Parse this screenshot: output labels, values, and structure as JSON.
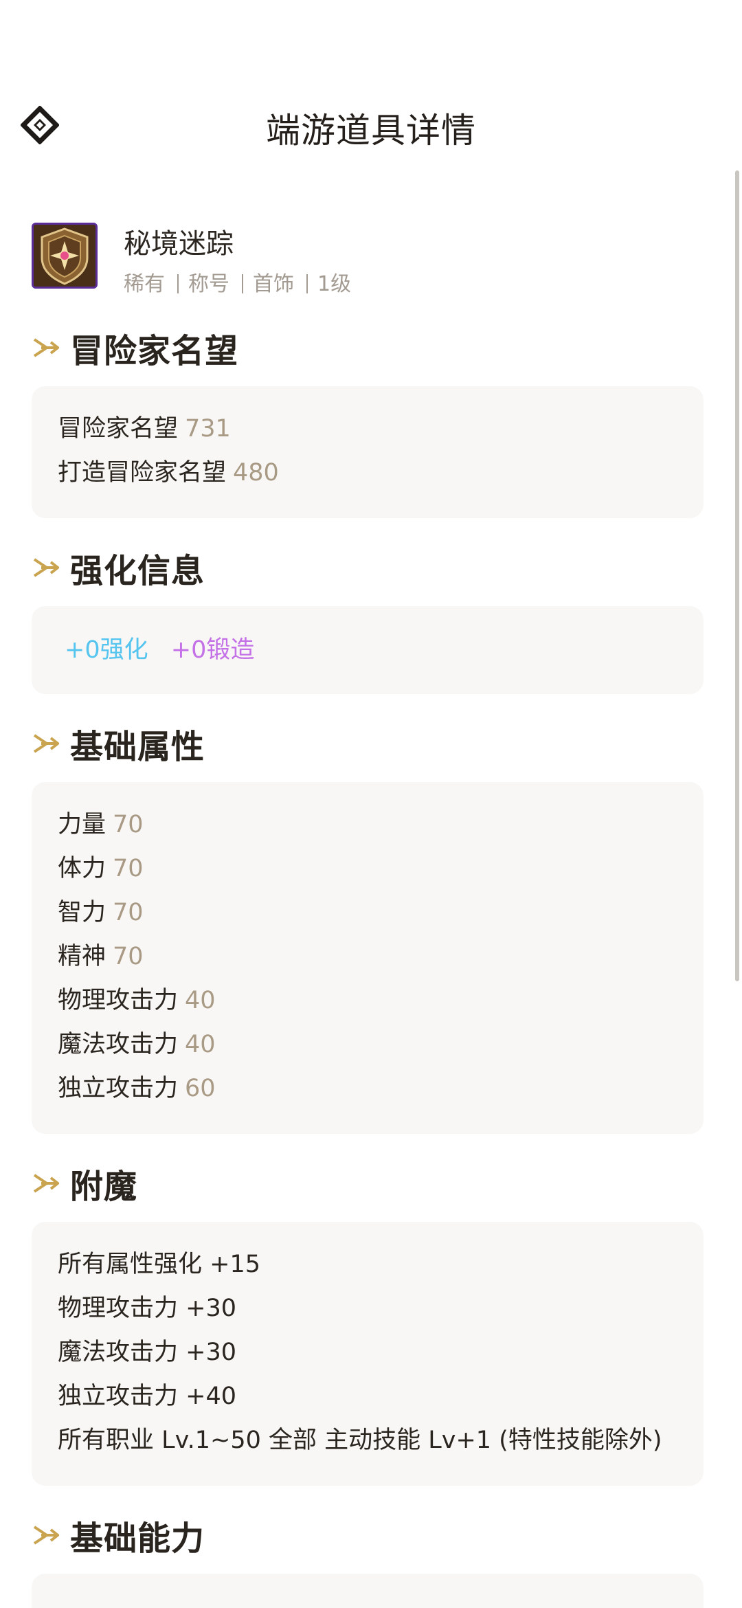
{
  "header": {
    "title": "端游道具详情"
  },
  "item": {
    "name": "秘境迷踪",
    "tags": [
      "稀有",
      "称号",
      "首饰",
      "1级"
    ]
  },
  "sections": {
    "reputation": {
      "title": "冒险家名望",
      "rows": [
        {
          "label": "冒险家名望",
          "value": "731"
        },
        {
          "label": "打造冒险家名望",
          "value": "480"
        }
      ]
    },
    "enhance": {
      "title": "强化信息",
      "reinforce": "+0强化",
      "forge": "+0锻造"
    },
    "base_attrs": {
      "title": "基础属性",
      "rows": [
        {
          "label": "力量",
          "value": "70"
        },
        {
          "label": "体力",
          "value": "70"
        },
        {
          "label": "智力",
          "value": "70"
        },
        {
          "label": "精神",
          "value": "70"
        },
        {
          "label": "物理攻击力",
          "value": "40"
        },
        {
          "label": "魔法攻击力",
          "value": "40"
        },
        {
          "label": "独立攻击力",
          "value": "60"
        }
      ]
    },
    "enchant": {
      "title": "附魔",
      "rows": [
        "所有属性强化 +15",
        "物理攻击力 +30",
        "魔法攻击力 +30",
        "独立攻击力 +40",
        "所有职业 Lv.1~50 全部 主动技能 Lv+1 (特性技能除外)"
      ]
    },
    "base_ability": {
      "title": "基础能力"
    }
  },
  "colors": {
    "accent_gold": "#c9a34e",
    "value_text": "#a89a84",
    "reinforce": "#55c4ee",
    "forge": "#c470e6",
    "card_bg": "#f8f7f5"
  }
}
